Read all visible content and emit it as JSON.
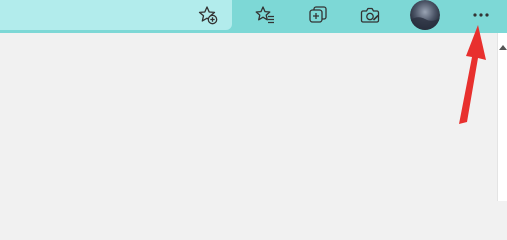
{
  "toolbar": {
    "buttons": [
      {
        "name": "add-favorite-icon"
      },
      {
        "name": "favorites-icon"
      },
      {
        "name": "collections-icon"
      },
      {
        "name": "browser-essentials-icon"
      },
      {
        "name": "profile-avatar"
      },
      {
        "name": "more-options-icon"
      }
    ]
  },
  "colors": {
    "toolbar_bg": "#7dd8d6",
    "address_bar_bg": "#b2ecec",
    "content_bg": "#f1f1f1",
    "annotation_arrow": "#e8302e"
  }
}
